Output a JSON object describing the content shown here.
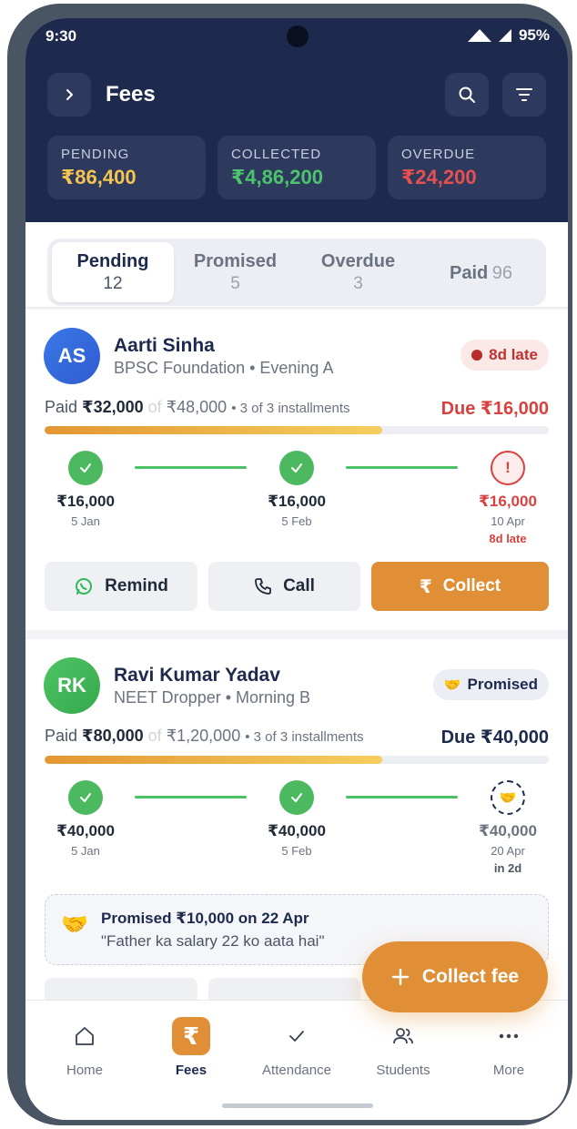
{
  "status_bar": {
    "time": "9:30",
    "battery": "95%"
  },
  "header": {
    "title": "Fees"
  },
  "stats": [
    {
      "label": "PENDING",
      "value": "₹86,400",
      "color": "#f5c451"
    },
    {
      "label": "COLLECTED",
      "value": "₹4,86,200",
      "color": "#4cc46b"
    },
    {
      "label": "OVERDUE",
      "value": "₹24,200",
      "color": "#e6504f"
    }
  ],
  "tabs": [
    {
      "label": "Pending",
      "count": "12",
      "active": true
    },
    {
      "label": "Promised",
      "count": "5"
    },
    {
      "label": "Overdue",
      "count": "3"
    },
    {
      "label": "Paid",
      "count": "96"
    }
  ],
  "students": [
    {
      "initials": "AS",
      "name": "Aarti Sinha",
      "meta": "BPSC Foundation • Evening A",
      "badge": "8d late",
      "paid_label": "Paid",
      "paid": "₹32,000",
      "of": "of",
      "total": "₹48,000",
      "installments": "• 3 of 3 installments",
      "due": "Due ₹16,000",
      "progress": 0.67,
      "milestones": [
        {
          "amount": "₹16,000",
          "date": "5 Jan",
          "state": "paid"
        },
        {
          "amount": "₹16,000",
          "date": "5 Feb",
          "state": "paid"
        },
        {
          "amount": "₹16,000",
          "date": "10 Apr",
          "note": "8d late",
          "state": "late"
        }
      ],
      "actions": {
        "remind": "Remind",
        "call": "Call",
        "collect": "Collect"
      }
    },
    {
      "initials": "RK",
      "name": "Ravi Kumar Yadav",
      "meta": "NEET Dropper • Morning B",
      "badge": "Promised",
      "paid_label": "Paid",
      "paid": "₹80,000",
      "of": "of",
      "total": "₹1,20,000",
      "installments": "• 3 of 3 installments",
      "due": "Due ₹40,000",
      "progress": 0.67,
      "milestones": [
        {
          "amount": "₹40,000",
          "date": "5 Jan",
          "state": "paid"
        },
        {
          "amount": "₹40,000",
          "date": "5 Feb",
          "state": "paid"
        },
        {
          "amount": "₹40,000",
          "date": "20 Apr",
          "note": "in 2d",
          "state": "promised"
        }
      ],
      "promise": {
        "title": "Promised ₹10,000 on 22 Apr",
        "note": "\"Father ka salary 22 ko aata hai\""
      }
    }
  ],
  "fab": {
    "label": "Collect fee"
  },
  "nav": [
    {
      "label": "Home"
    },
    {
      "label": "Fees",
      "active": true
    },
    {
      "label": "Attendance"
    },
    {
      "label": "Students"
    },
    {
      "label": "More"
    }
  ]
}
